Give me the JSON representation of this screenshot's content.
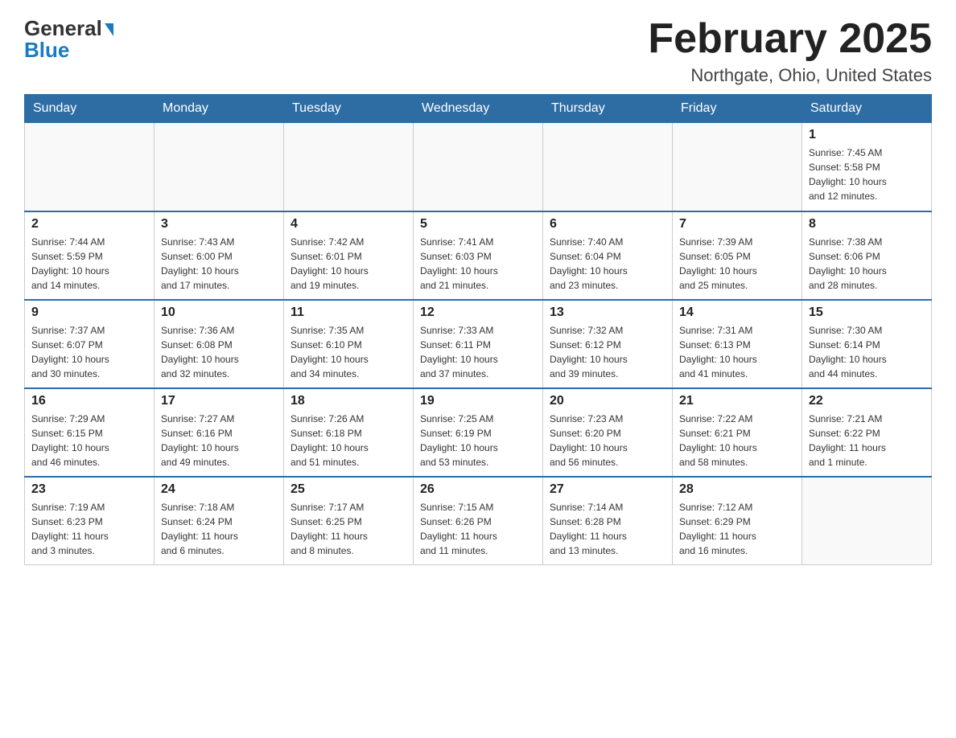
{
  "header": {
    "logo_general": "General",
    "logo_blue": "Blue",
    "main_title": "February 2025",
    "subtitle": "Northgate, Ohio, United States"
  },
  "days_of_week": [
    "Sunday",
    "Monday",
    "Tuesday",
    "Wednesday",
    "Thursday",
    "Friday",
    "Saturday"
  ],
  "weeks": [
    [
      {
        "day": "",
        "info": ""
      },
      {
        "day": "",
        "info": ""
      },
      {
        "day": "",
        "info": ""
      },
      {
        "day": "",
        "info": ""
      },
      {
        "day": "",
        "info": ""
      },
      {
        "day": "",
        "info": ""
      },
      {
        "day": "1",
        "info": "Sunrise: 7:45 AM\nSunset: 5:58 PM\nDaylight: 10 hours\nand 12 minutes."
      }
    ],
    [
      {
        "day": "2",
        "info": "Sunrise: 7:44 AM\nSunset: 5:59 PM\nDaylight: 10 hours\nand 14 minutes."
      },
      {
        "day": "3",
        "info": "Sunrise: 7:43 AM\nSunset: 6:00 PM\nDaylight: 10 hours\nand 17 minutes."
      },
      {
        "day": "4",
        "info": "Sunrise: 7:42 AM\nSunset: 6:01 PM\nDaylight: 10 hours\nand 19 minutes."
      },
      {
        "day": "5",
        "info": "Sunrise: 7:41 AM\nSunset: 6:03 PM\nDaylight: 10 hours\nand 21 minutes."
      },
      {
        "day": "6",
        "info": "Sunrise: 7:40 AM\nSunset: 6:04 PM\nDaylight: 10 hours\nand 23 minutes."
      },
      {
        "day": "7",
        "info": "Sunrise: 7:39 AM\nSunset: 6:05 PM\nDaylight: 10 hours\nand 25 minutes."
      },
      {
        "day": "8",
        "info": "Sunrise: 7:38 AM\nSunset: 6:06 PM\nDaylight: 10 hours\nand 28 minutes."
      }
    ],
    [
      {
        "day": "9",
        "info": "Sunrise: 7:37 AM\nSunset: 6:07 PM\nDaylight: 10 hours\nand 30 minutes."
      },
      {
        "day": "10",
        "info": "Sunrise: 7:36 AM\nSunset: 6:08 PM\nDaylight: 10 hours\nand 32 minutes."
      },
      {
        "day": "11",
        "info": "Sunrise: 7:35 AM\nSunset: 6:10 PM\nDaylight: 10 hours\nand 34 minutes."
      },
      {
        "day": "12",
        "info": "Sunrise: 7:33 AM\nSunset: 6:11 PM\nDaylight: 10 hours\nand 37 minutes."
      },
      {
        "day": "13",
        "info": "Sunrise: 7:32 AM\nSunset: 6:12 PM\nDaylight: 10 hours\nand 39 minutes."
      },
      {
        "day": "14",
        "info": "Sunrise: 7:31 AM\nSunset: 6:13 PM\nDaylight: 10 hours\nand 41 minutes."
      },
      {
        "day": "15",
        "info": "Sunrise: 7:30 AM\nSunset: 6:14 PM\nDaylight: 10 hours\nand 44 minutes."
      }
    ],
    [
      {
        "day": "16",
        "info": "Sunrise: 7:29 AM\nSunset: 6:15 PM\nDaylight: 10 hours\nand 46 minutes."
      },
      {
        "day": "17",
        "info": "Sunrise: 7:27 AM\nSunset: 6:16 PM\nDaylight: 10 hours\nand 49 minutes."
      },
      {
        "day": "18",
        "info": "Sunrise: 7:26 AM\nSunset: 6:18 PM\nDaylight: 10 hours\nand 51 minutes."
      },
      {
        "day": "19",
        "info": "Sunrise: 7:25 AM\nSunset: 6:19 PM\nDaylight: 10 hours\nand 53 minutes."
      },
      {
        "day": "20",
        "info": "Sunrise: 7:23 AM\nSunset: 6:20 PM\nDaylight: 10 hours\nand 56 minutes."
      },
      {
        "day": "21",
        "info": "Sunrise: 7:22 AM\nSunset: 6:21 PM\nDaylight: 10 hours\nand 58 minutes."
      },
      {
        "day": "22",
        "info": "Sunrise: 7:21 AM\nSunset: 6:22 PM\nDaylight: 11 hours\nand 1 minute."
      }
    ],
    [
      {
        "day": "23",
        "info": "Sunrise: 7:19 AM\nSunset: 6:23 PM\nDaylight: 11 hours\nand 3 minutes."
      },
      {
        "day": "24",
        "info": "Sunrise: 7:18 AM\nSunset: 6:24 PM\nDaylight: 11 hours\nand 6 minutes."
      },
      {
        "day": "25",
        "info": "Sunrise: 7:17 AM\nSunset: 6:25 PM\nDaylight: 11 hours\nand 8 minutes."
      },
      {
        "day": "26",
        "info": "Sunrise: 7:15 AM\nSunset: 6:26 PM\nDaylight: 11 hours\nand 11 minutes."
      },
      {
        "day": "27",
        "info": "Sunrise: 7:14 AM\nSunset: 6:28 PM\nDaylight: 11 hours\nand 13 minutes."
      },
      {
        "day": "28",
        "info": "Sunrise: 7:12 AM\nSunset: 6:29 PM\nDaylight: 11 hours\nand 16 minutes."
      },
      {
        "day": "",
        "info": ""
      }
    ]
  ]
}
